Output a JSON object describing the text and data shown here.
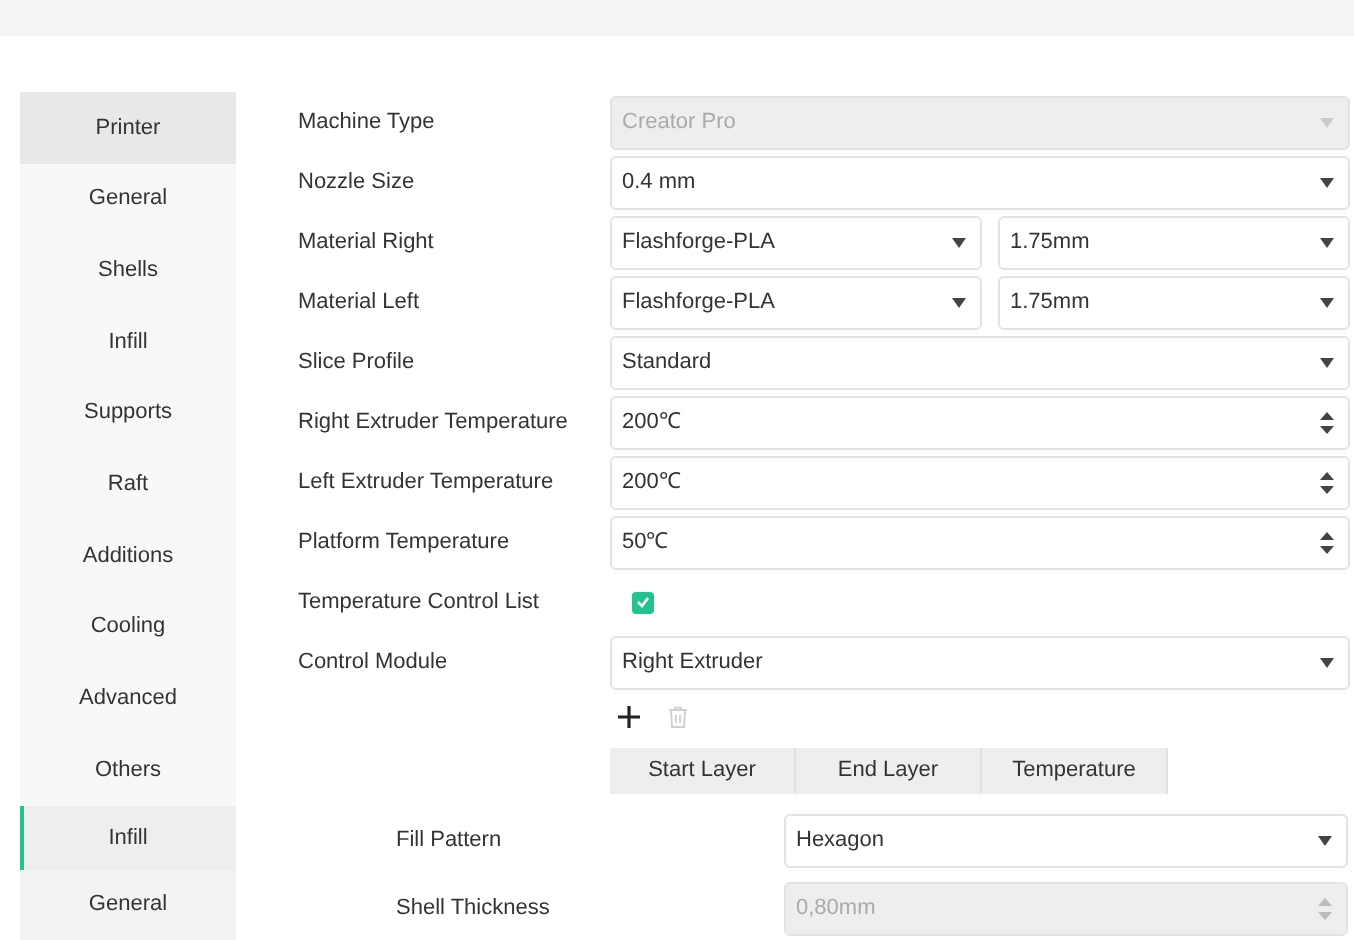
{
  "sidebar": {
    "items": [
      {
        "label": "Printer",
        "selected": true
      },
      {
        "label": "General",
        "selected": false
      },
      {
        "label": "Shells",
        "selected": false
      },
      {
        "label": "Infill",
        "selected": false
      },
      {
        "label": "Supports",
        "selected": false
      },
      {
        "label": "Raft",
        "selected": false
      },
      {
        "label": "Additions",
        "selected": false
      },
      {
        "label": "Cooling",
        "selected": false
      },
      {
        "label": "Advanced",
        "selected": false
      },
      {
        "label": "Others",
        "selected": false
      }
    ]
  },
  "form": {
    "rows": [
      {
        "kind": "select",
        "label": "Machine Type",
        "value": "Creator Pro",
        "disabled": true
      },
      {
        "kind": "select",
        "label": "Nozzle Size",
        "value": "0.4 mm",
        "disabled": false
      },
      {
        "kind": "pair",
        "label": "Material Right",
        "value": "Flashforge-PLA",
        "value_2": "1.75mm"
      },
      {
        "kind": "pair",
        "label": "Material Left",
        "value": "Flashforge-PLA",
        "value_2": "1.75mm"
      },
      {
        "kind": "select",
        "label": "Slice Profile",
        "value": "Standard",
        "disabled": false
      },
      {
        "kind": "spin",
        "label": "Right Extruder Temperature",
        "value": "200℃",
        "disabled": false
      },
      {
        "kind": "spin",
        "label": "Left Extruder Temperature",
        "value": "200℃",
        "disabled": false
      },
      {
        "kind": "spin",
        "label": "Platform Temperature",
        "value": "50℃",
        "disabled": false
      },
      {
        "kind": "checkbox",
        "label": "Temperature Control List",
        "checked": true
      },
      {
        "kind": "select",
        "label": "Control Module",
        "value": "Right Extruder",
        "disabled": false
      }
    ],
    "list_buttons": {
      "add_disabled": false,
      "delete_disabled": true
    },
    "table": {
      "columns": [
        "Start Layer",
        "End Layer",
        "Temperature"
      ]
    }
  },
  "overlay": {
    "sidebar": {
      "items": [
        {
          "label": "Infill",
          "selected": true
        },
        {
          "label": "General",
          "selected": false
        }
      ]
    },
    "rows": [
      {
        "kind": "select",
        "label": "Fill Pattern",
        "value": "Hexagon",
        "disabled": false
      },
      {
        "kind": "spin",
        "label": "Shell Thickness",
        "value": "0,80mm",
        "disabled": true
      }
    ]
  }
}
